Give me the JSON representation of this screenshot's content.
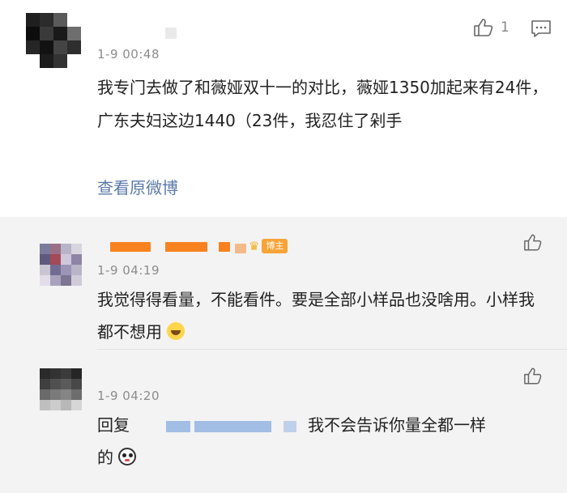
{
  "main_comment": {
    "timestamp": "1-9 00:48",
    "text": "我专门去做了和薇娅双十一的对比，薇娅1350加起来有24件，广东夫妇这边1440（23件，我忍住了剁手",
    "view_original_label": "查看原微博",
    "like_count": "1",
    "avatar_colors": [
      "#1f1f1f",
      "#2b2b2b",
      "#5a5a5a",
      "#ffffff",
      "#0d0d0d",
      "#3a3a3a",
      "#1a1a1a",
      "#6e6e6e",
      "#262626",
      "#121212",
      "#444444",
      "#2e2e2e",
      "#ffffff",
      "#1c1c1c",
      "#333333",
      "#ffffff"
    ]
  },
  "replies": [
    {
      "timestamp": "1-9 04:19",
      "author_badge": "博主",
      "text": "我觉得得看量，不能看件。要是全部小样品也没啥用。小样我都不想用",
      "avatar_colors": [
        "#7c7a9c",
        "#9c6f88",
        "#b7b3c9",
        "#d8d4e0",
        "#5f5a7d",
        "#a24b56",
        "#cfc7da",
        "#8d84a6",
        "#cbc5d3",
        "#716c92",
        "#9d95b5",
        "#b9b4c8",
        "#e2dde8",
        "#a9a2be",
        "#7d7693",
        "#d0cad9"
      ]
    },
    {
      "timestamp": "1-9 04:20",
      "reply_prefix": "回复",
      "text_after_mention": "我不会告诉你量全都一样",
      "text_end": "的",
      "avatar_colors": [
        "#2a2a2a",
        "#333333",
        "#3b3b3b",
        "#262626",
        "#3f3f3f",
        "#505050",
        "#5a5a5a",
        "#484848",
        "#6a6a6a",
        "#7a7a7a",
        "#858585",
        "#6d6d6d",
        "#bfbfbf",
        "#cccccc",
        "#b8b8b8",
        "#d6d6d6"
      ]
    }
  ],
  "icons": {
    "like": "thumbs-up-icon",
    "reply": "comment-icon",
    "crown": "crown-icon"
  },
  "colors": {
    "link": "#5b7aa8",
    "reply_background": "#f3f3f3",
    "author_tag": "#f7a335",
    "name_obscured": "#f7821f"
  }
}
